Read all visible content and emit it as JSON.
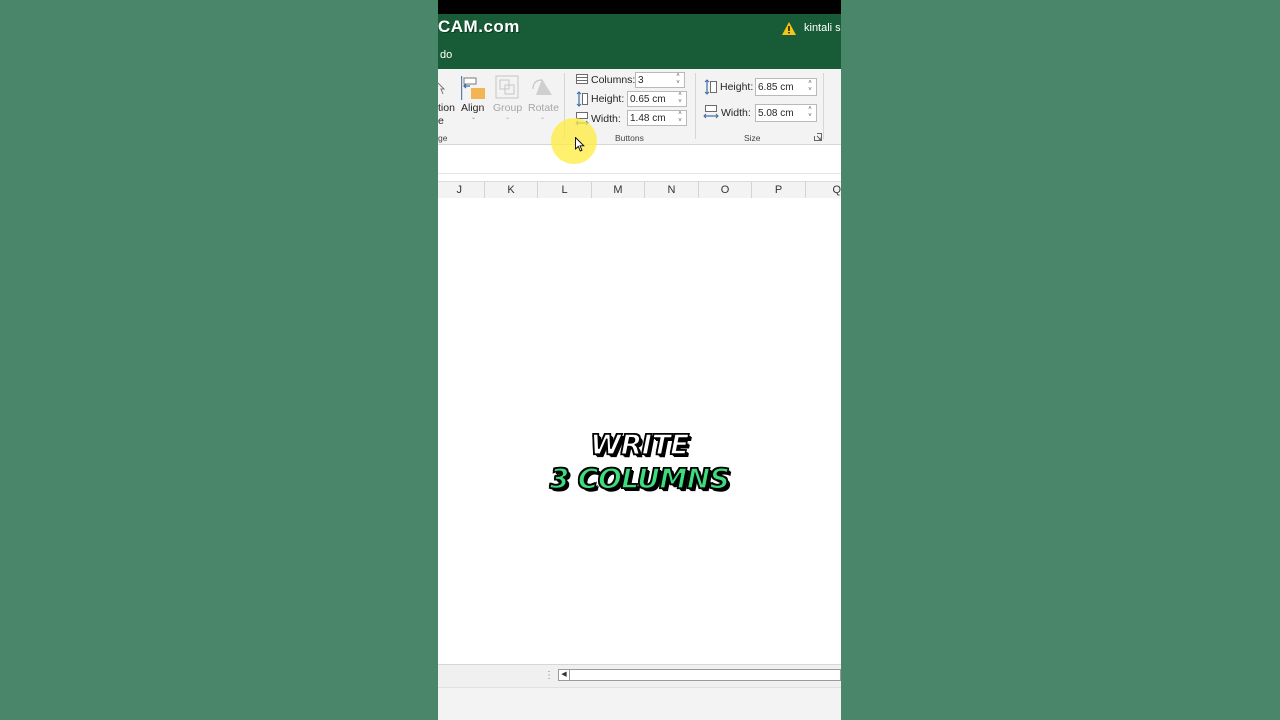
{
  "app": {
    "logo_text": "CAM.com",
    "user_name": "kintali sr",
    "tell_me_text": "do",
    "accent_color": "#185c37",
    "background_color": "#4a8669"
  },
  "ribbon": {
    "arrange": {
      "selection_pane_line1": "tion",
      "selection_pane_line2": "e",
      "align_label": "Align",
      "group_btn_label": "Group",
      "rotate_label": "Rotate",
      "group_label": "ge"
    },
    "buttons": {
      "columns_label": "Columns:",
      "columns_value": "3",
      "height_label": "Height:",
      "height_value": "0.65 cm",
      "width_label": "Width:",
      "width_value": "1.48 cm",
      "group_label": "Buttons"
    },
    "size": {
      "height_label": "Height:",
      "height_value": "6.85 cm",
      "width_label": "Width:",
      "width_value": "5.08 cm",
      "group_label": "Size"
    }
  },
  "sheet": {
    "columns": [
      "J",
      "K",
      "L",
      "M",
      "N",
      "O",
      "P",
      "Q"
    ]
  },
  "caption": {
    "line1": "WRITE",
    "line2": "3 COLUMNS",
    "line2_color": "#3ddc7c"
  },
  "icons": [
    "warning-icon",
    "align-icon",
    "group-icon",
    "rotate-icon",
    "columns-icon",
    "height-icon",
    "width-icon",
    "dialog-launcher-icon",
    "mouse-cursor-icon",
    "scroll-left-icon"
  ]
}
